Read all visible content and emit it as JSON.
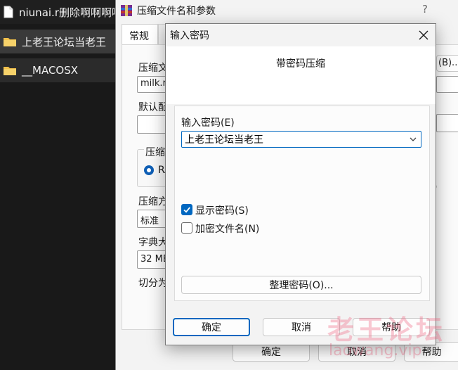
{
  "explorer": {
    "items": [
      {
        "label": "niunai.r删除啊啊啊啊",
        "icon": "file-icon"
      },
      {
        "label": "上老王论坛当老王",
        "icon": "folder-icon"
      },
      {
        "label": "__MACOSX",
        "icon": "folder-icon"
      }
    ]
  },
  "bg_dialog": {
    "title": "压缩文件名和参数",
    "help": "?",
    "tab_general": "常规",
    "archive_name_label": "压缩文",
    "archive_name_value": "milk.ra",
    "browse_label": "(B)...",
    "default_profile_label": "默认配",
    "format_group_label": "压缩",
    "format_rar_label": "RA",
    "method_label": "压缩方",
    "method_value": "标准",
    "dict_label": "字典大",
    "dict_value": "32 MB",
    "split_label": "切分为",
    "side_paren": ")",
    "ok": "确定",
    "cancel": "取消",
    "help_btn": "帮助"
  },
  "dialog": {
    "title": "输入密码",
    "subtitle": "带密码压缩",
    "password_label": "输入密码(E)",
    "password_value": "上老王论坛当老王",
    "show_password_label": "显示密码(S)",
    "show_password_checked": true,
    "encrypt_names_label": "加密文件名(N)",
    "encrypt_names_checked": false,
    "organize_button": "整理密码(O)...",
    "ok": "确定",
    "cancel": "取消",
    "help": "帮助"
  },
  "watermark": {
    "line1": "老王论坛",
    "line2": "laowang.vip"
  },
  "colors": {
    "accent": "#0067c0",
    "folder": "#f2c14b",
    "explorer_bg": "#191919"
  }
}
